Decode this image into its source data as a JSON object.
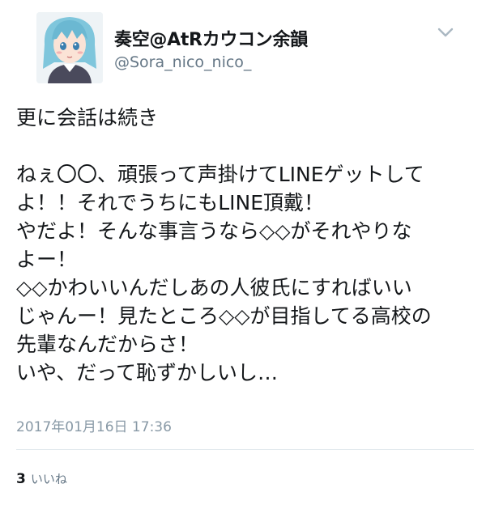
{
  "tweet": {
    "author": {
      "display_name": "奏空@AtRカウコン余韻",
      "handle": "@Sora_nico_nico_",
      "avatar_icon": "anime-avatar-icon"
    },
    "menu_icon": "chevron-down-icon",
    "body_lines": [
      "更に会話は続き",
      "",
      "ねぇ〇〇、頑張って声掛けてLINEゲットして",
      "よ！！それでうちにもLINE頂戴！",
      "やだよ！そんな事言うなら◇◇がそれやりな",
      "よー！",
      "◇◇かわいいんだしあの人彼氏にすればいい",
      "じゃんー！見たところ◇◇が目指してる高校の",
      "先輩なんだからさ！",
      "いや、だって恥ずかしいし…"
    ],
    "timestamp": "2017年01月16日 17:36",
    "likes": {
      "count": "3",
      "label": "いいね"
    }
  },
  "colors": {
    "text": "#14171a",
    "secondary": "#657786",
    "timestamp": "#8899a6",
    "divider": "#e1e8ed",
    "avatar_hair": "#7fc6dc"
  }
}
